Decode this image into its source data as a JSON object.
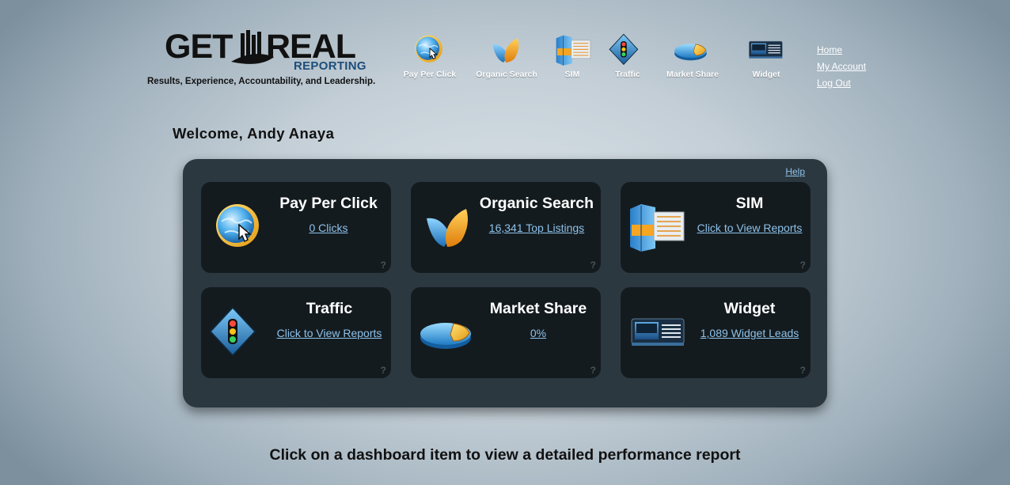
{
  "logo": {
    "word_left": "GET",
    "word_right": "REAL",
    "sub": "REPORTING",
    "tagline": "Results, Experience, Accountability, and Leadership."
  },
  "nav": [
    {
      "label": "Pay Per Click",
      "icon": "globe-cursor-icon"
    },
    {
      "label": "Organic Search",
      "icon": "leaf-icon"
    },
    {
      "label": "SIM",
      "icon": "sim-panels-icon"
    },
    {
      "label": "Traffic",
      "icon": "traffic-light-icon"
    },
    {
      "label": "Market Share",
      "icon": "pie-chart-icon"
    },
    {
      "label": "Widget",
      "icon": "widget-screen-icon"
    }
  ],
  "account": {
    "home": "Home",
    "my_account": "My Account",
    "logout": "Log Out"
  },
  "welcome": "Welcome, Andy Anaya",
  "dashboard": {
    "help": "Help",
    "tiles": [
      {
        "title": "Pay Per Click",
        "link": "0 Clicks",
        "q": "?"
      },
      {
        "title": "Organic Search",
        "link": "16,341 Top Listings",
        "q": "?"
      },
      {
        "title": "SIM",
        "link": "Click to View Reports",
        "q": "?"
      },
      {
        "title": "Traffic",
        "link": "Click to View Reports",
        "q": "?"
      },
      {
        "title": "Market Share",
        "link": "0%",
        "q": "?"
      },
      {
        "title": "Widget",
        "link": "1,089 Widget Leads",
        "q": "?"
      }
    ]
  },
  "footer": "Click on a dashboard item to view a detailed performance report",
  "colors": {
    "link": "#8ec2ea",
    "panel": "#2c3840",
    "tile": "#141b1f",
    "brand_blue": "#1d4e7a"
  }
}
